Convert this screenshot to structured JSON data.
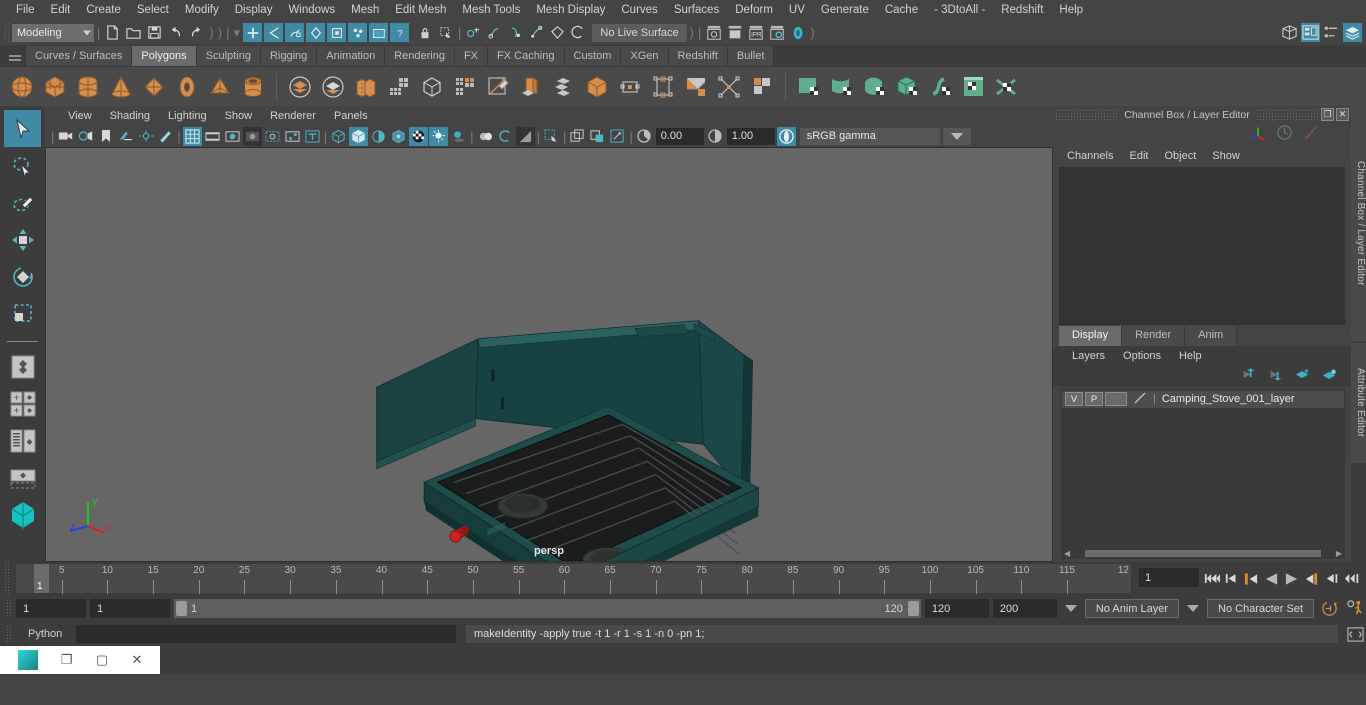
{
  "menubar": {
    "items": [
      "File",
      "Edit",
      "Create",
      "Select",
      "Modify",
      "Display",
      "Windows",
      "Mesh",
      "Edit Mesh",
      "Mesh Tools",
      "Mesh Display",
      "Curves",
      "Surfaces",
      "Deform",
      "UV",
      "Generate",
      "Cache",
      "- 3DtoAll -",
      "Redshift",
      "Help"
    ]
  },
  "statusline": {
    "menuset": "Modeling",
    "live_surface": "No Live Surface",
    "tooltips": {
      "new": "New Scene",
      "open": "Open Scene",
      "save": "Save Scene",
      "undo": "Undo",
      "redo": "Redo",
      "select_by_hierarchy": "Select by hierarchy",
      "select_by_object": "Select by object type",
      "select_by_component": "Select by component type",
      "lock": "Lock selection",
      "highlight": "Highlight selection"
    }
  },
  "shelf": {
    "tabs": [
      "Curves / Surfaces",
      "Polygons",
      "Sculpting",
      "Rigging",
      "Animation",
      "Rendering",
      "FX",
      "FX Caching",
      "Custom",
      "XGen",
      "Redshift",
      "Bullet"
    ],
    "active_tab": "Polygons",
    "icons": [
      {
        "name": "poly-sphere",
        "color": "#d58e4e"
      },
      {
        "name": "poly-cube",
        "color": "#d58e4e"
      },
      {
        "name": "poly-cylinder",
        "color": "#d58e4e"
      },
      {
        "name": "poly-cone",
        "color": "#d58e4e"
      },
      {
        "name": "poly-plane",
        "color": "#d58e4e"
      },
      {
        "name": "poly-torus",
        "color": "#d58e4e"
      },
      {
        "name": "poly-pyramid",
        "color": "#d58e4e"
      },
      {
        "name": "poly-pipe",
        "color": "#d58e4e"
      },
      {
        "name": "poly-boolean-union",
        "color": "#d58e4e"
      },
      {
        "name": "poly-boolean-difference",
        "color": "#d58e4e"
      },
      {
        "name": "poly-combine",
        "color": "#d58e4e"
      },
      {
        "name": "poly-smooth",
        "color": "#bdbdbd"
      },
      {
        "name": "poly-extract",
        "color": "#bdbdbd"
      },
      {
        "name": "poly-quad-draw",
        "color": "#bdbdbd"
      },
      {
        "name": "poly-multi-cut",
        "color": "#d58e4e"
      },
      {
        "name": "poly-bevel",
        "color": "#d58e4e"
      },
      {
        "name": "poly-duplicate-face",
        "color": "#bdbdbd"
      },
      {
        "name": "poly-extrude",
        "color": "#d58e4e"
      },
      {
        "name": "poly-bridge",
        "color": "#bdbdbd"
      },
      {
        "name": "poly-append",
        "color": "#bdbdbd"
      },
      {
        "name": "poly-wedge",
        "color": "#d58e4e"
      },
      {
        "name": "poly-chamfer",
        "color": "#bdbdbd"
      },
      {
        "name": "poly-mirror",
        "color": "#d58e4e"
      },
      {
        "name": "uv-planar",
        "color": "#5faf8c"
      },
      {
        "name": "uv-cylindrical",
        "color": "#5faf8c"
      },
      {
        "name": "uv-spherical",
        "color": "#5faf8c"
      },
      {
        "name": "uv-automatic",
        "color": "#5faf8c"
      },
      {
        "name": "uv-contour-stretch",
        "color": "#5faf8c"
      },
      {
        "name": "uv-editor",
        "color": "#5faf8c"
      },
      {
        "name": "uv-unfold",
        "color": "#5faf8c"
      }
    ]
  },
  "toolbox": {
    "items": [
      {
        "name": "select-tool",
        "selected": true
      },
      {
        "name": "lasso-select-tool",
        "selected": false
      },
      {
        "name": "paint-select-tool",
        "selected": false
      },
      {
        "name": "move-tool",
        "selected": false
      },
      {
        "name": "rotate-tool",
        "selected": false
      },
      {
        "name": "scale-tool",
        "selected": false
      },
      {
        "name": "last-tool",
        "selected": false
      },
      {
        "name": "single-perspective-view",
        "selected": false
      },
      {
        "name": "four-view-layout",
        "selected": false
      },
      {
        "name": "outliner-persp-layout",
        "selected": false
      },
      {
        "name": "persp-graph-layout",
        "selected": false
      }
    ]
  },
  "viewport": {
    "menus": [
      "View",
      "Shading",
      "Lighting",
      "Show",
      "Renderer",
      "Panels"
    ],
    "camera_label": "persp",
    "exposure": "0.00",
    "gamma": "1.00",
    "color_management": "sRGB gamma",
    "cm_enabled": "ON",
    "axis": {
      "x": "x",
      "y": "y",
      "z": "z"
    },
    "model": {
      "name": "Camping Stove",
      "body_color": "#1e4a49",
      "grate_color": "#1b1b1b",
      "knob_color": "#bb2222",
      "background": "#666666"
    }
  },
  "channelbox": {
    "title": "Channel Box / Layer Editor",
    "menus": [
      "Channels",
      "Edit",
      "Object",
      "Show"
    ],
    "window_buttons": [
      "restore",
      "close"
    ],
    "icons": [
      "axis-gizmo-icon",
      "clock-icon",
      "curve-icon"
    ]
  },
  "layer_editor": {
    "tabs": [
      "Display",
      "Render",
      "Anim"
    ],
    "active_tab": "Display",
    "menus": [
      "Layers",
      "Options",
      "Help"
    ],
    "buttons": [
      "move-layer-up-icon",
      "move-layer-down-icon",
      "new-layer-icon",
      "new-layer-from-selected-icon"
    ],
    "layers": [
      {
        "visibility": "V",
        "playback": "P",
        "color": "",
        "name": "Camping_Stove_001_layer"
      }
    ]
  },
  "sidetabs": [
    "Channel Box / Layer Editor",
    "Attribute Editor"
  ],
  "timeslider": {
    "ticks": [
      5,
      10,
      15,
      20,
      25,
      30,
      35,
      40,
      45,
      50,
      55,
      60,
      65,
      70,
      75,
      80,
      85,
      90,
      95,
      100,
      105,
      110,
      115
    ],
    "end_label": "12",
    "current_frame": "1",
    "current_field": "1",
    "playback_buttons": [
      "go-to-start",
      "step-back-key",
      "step-back-frame",
      "play-backwards",
      "play-forwards",
      "step-forward-frame",
      "step-forward-key",
      "go-to-end"
    ]
  },
  "rangeslider": {
    "start_field": "1",
    "start_range_field": "1",
    "range_low": "1",
    "range_high": "120",
    "end_range_field": "120",
    "end_field": "200",
    "anim_layer": "No Anim Layer",
    "character_set": "No Character Set",
    "icons": [
      "auto-keyframe-icon",
      "animation-preferences-icon"
    ]
  },
  "commandline": {
    "language": "Python",
    "input_value": "",
    "output": "makeIdentity -apply true -t 1 -r 1 -s 1 -n 0 -pn 1;",
    "script_editor_icon": "script-editor-icon"
  },
  "taskbar": {
    "app_icon": "maya-app-icon",
    "buttons": [
      "restore-window",
      "maximize-window",
      "close-window"
    ],
    "glyphs": {
      "restore": "❐",
      "maximize": "▢",
      "close": "✕"
    }
  },
  "colors": {
    "accent_blue": "#3f8ba7",
    "shelf_orange": "#d58e4e",
    "uv_green": "#5faf8c",
    "panel_bg": "#444444",
    "viewport_bg": "#666666"
  }
}
